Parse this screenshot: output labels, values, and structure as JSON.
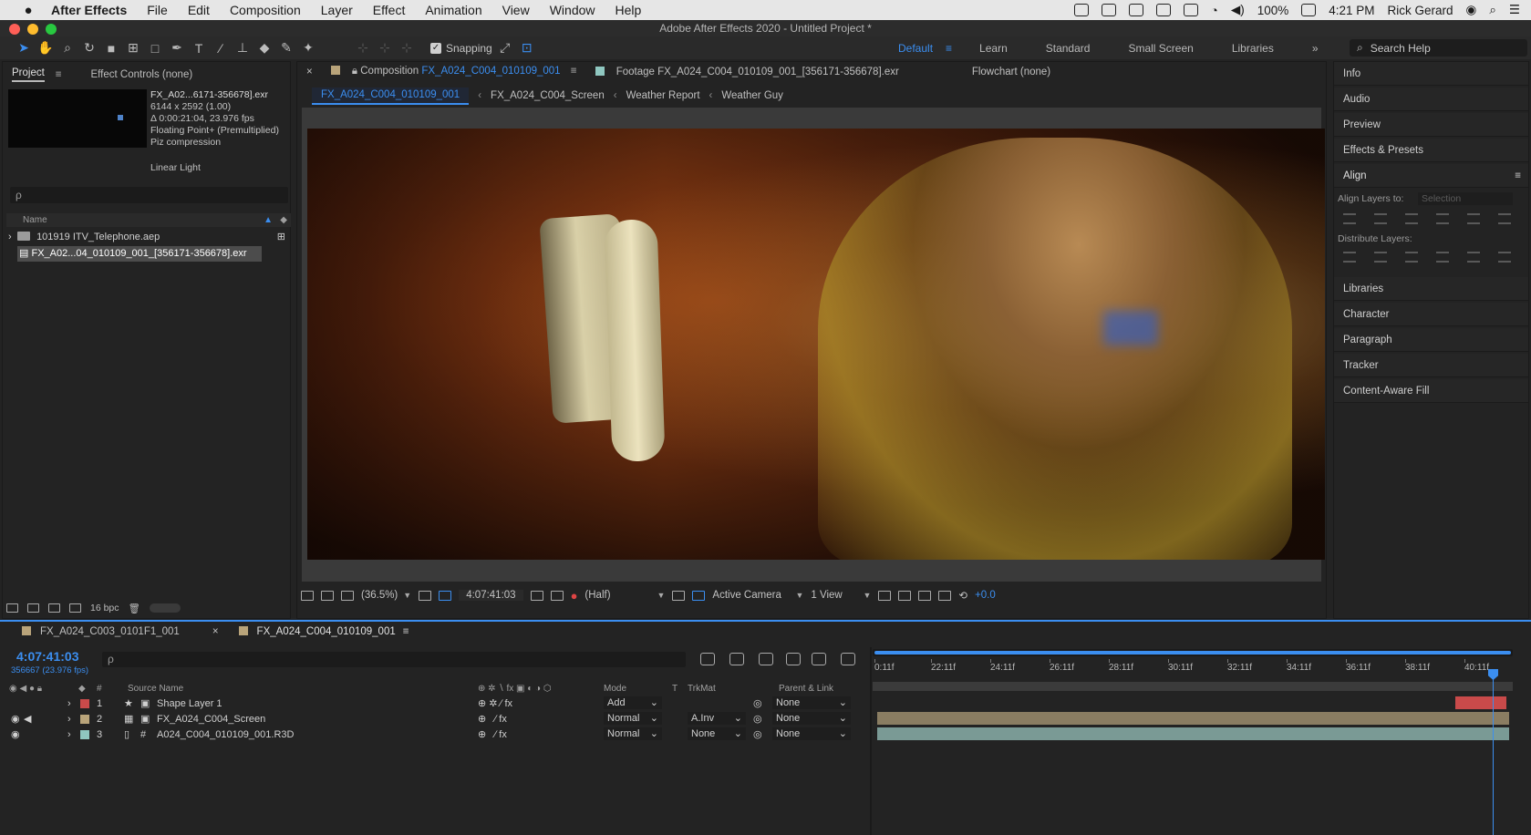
{
  "menubar": {
    "apple": "",
    "app": "After Effects",
    "items": [
      "File",
      "Edit",
      "Composition",
      "Layer",
      "Effect",
      "Animation",
      "View",
      "Window",
      "Help"
    ],
    "battery": "100%",
    "time": "4:21 PM",
    "user": "Rick Gerard"
  },
  "window": {
    "title": "Adobe After Effects 2020 - Untitled Project *"
  },
  "toolbar": {
    "snapping_label": "Snapping",
    "workspaces": [
      "Default",
      "Learn",
      "Standard",
      "Small Screen",
      "Libraries"
    ],
    "search_help": "Search Help"
  },
  "project": {
    "tab_project": "Project",
    "tab_effect_controls": "Effect Controls (none)",
    "meta": {
      "filename": "FX_A02...6171-356678].exr",
      "dimensions": "6144 x 2592 (1.00)",
      "duration": "Δ 0:00:21:04, 23.976 fps",
      "color": "Floating Point+ (Premultiplied)",
      "compression": "Piz compression",
      "linear": "Linear Light"
    },
    "search_placeholder": "ρ",
    "column_name": "Name",
    "items": [
      {
        "label": "101919 ITV_Telephone.aep"
      },
      {
        "label": "FX_A02...04_010109_001_[356171-356678].exr"
      }
    ],
    "bpc": "16 bpc"
  },
  "viewer": {
    "comp_tab_prefix": "Composition",
    "comp_tab_name": "FX_A024_C004_010109_001",
    "footage_tab": "Footage FX_A024_C004_010109_001_[356171-356678].exr",
    "flowchart_tab": "Flowchart (none)",
    "breadcrumbs": [
      "FX_A024_C004_010109_001",
      "FX_A024_C004_Screen",
      "Weather Report",
      "Weather Guy"
    ],
    "zoom": "(36.5%)",
    "timecode": "4:07:41:03",
    "resolution": "(Half)",
    "camera": "Active Camera",
    "views": "1 View",
    "exposure": "+0.0"
  },
  "side_panels": {
    "items": [
      "Info",
      "Audio",
      "Preview",
      "Effects & Presets",
      "Align",
      "Libraries",
      "Character",
      "Paragraph",
      "Tracker",
      "Content-Aware Fill"
    ],
    "align_layers_to": "Align Layers to:",
    "align_selection": "Selection",
    "distribute_layers": "Distribute Layers:"
  },
  "timeline": {
    "tabs": [
      {
        "label": "FX_A024_C003_0101F1_001",
        "swatch": "#b9a47a"
      },
      {
        "label": "FX_A024_C004_010109_001",
        "swatch": "#b9a47a"
      }
    ],
    "timecode": "4:07:41:03",
    "frames": "356667 (23.976 fps)",
    "headers": {
      "num": "#",
      "source": "Source Name",
      "mode": "Mode",
      "t": "T",
      "trkmat": "TrkMat",
      "parent": "Parent & Link"
    },
    "layers": [
      {
        "num": "1",
        "name": "Shape Layer 1",
        "mode": "Add",
        "trkmat": "",
        "parent": "None",
        "color": "#c94a4a"
      },
      {
        "num": "2",
        "name": "FX_A024_C004_Screen",
        "mode": "Normal",
        "trkmat": "A.Inv",
        "parent": "None",
        "color": "#b9a47a"
      },
      {
        "num": "3",
        "name": "A024_C004_010109_001.R3D",
        "mode": "Normal",
        "trkmat": "None",
        "parent": "None",
        "color": "#8fc7c0"
      }
    ],
    "ruler_ticks": [
      "0:11f",
      "22:11f",
      "24:11f",
      "26:11f",
      "28:11f",
      "30:11f",
      "32:11f",
      "34:11f",
      "36:11f",
      "38:11f",
      "40:11f"
    ],
    "track_colors": [
      "#c94a4a",
      "#8a7d62",
      "#7a9a95"
    ]
  }
}
